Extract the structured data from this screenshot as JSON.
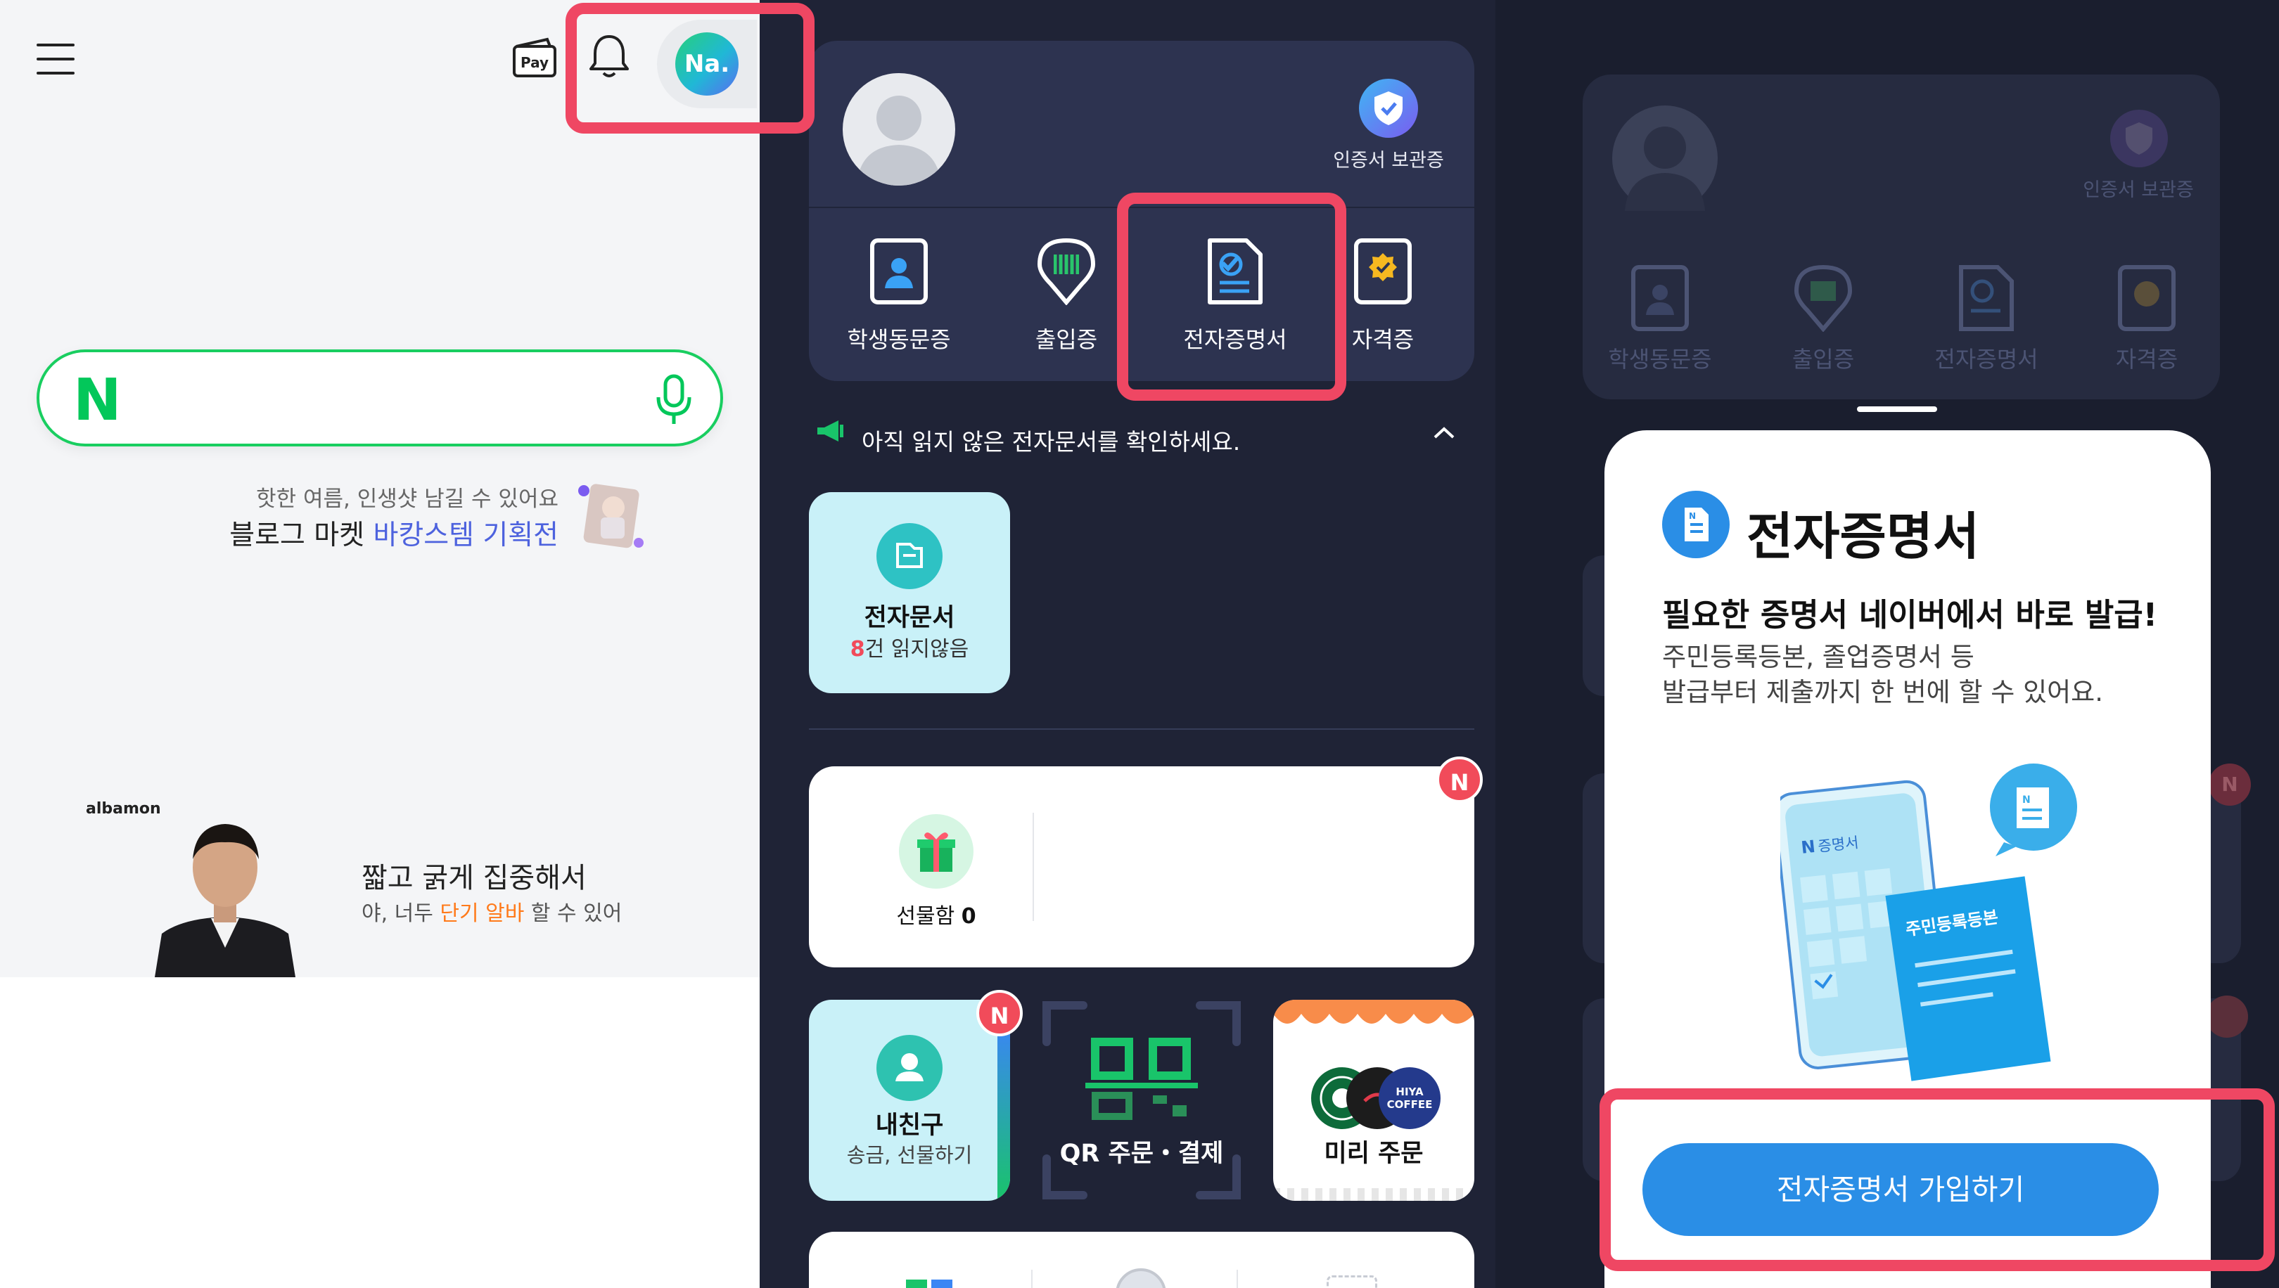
{
  "panel1": {
    "header": {
      "pay_label": "Pay",
      "avatar_text": "Na."
    },
    "promo": {
      "subtitle": "핫한 여름, 인생샷 남길 수 있어요",
      "title_prefix": "블로그 마켓 ",
      "title_accent": "바캉스템 기획전"
    },
    "ad": {
      "brand": "albamon",
      "title": "짧고 굵게 집중해서",
      "sub_prefix": "야, 너두 ",
      "sub_accent": "단기 알바",
      "sub_suffix": " 할 수 있어"
    }
  },
  "panel2": {
    "cert_storage_label": "인증서 보관증",
    "quick_items": [
      {
        "label": "학생동문증"
      },
      {
        "label": "출입증"
      },
      {
        "label": "전자증명서"
      },
      {
        "label": "자격증"
      }
    ],
    "notice": "아직 읽지 않은 전자문서를 확인하세요.",
    "edoc": {
      "title": "전자문서",
      "count": "8",
      "unread_suffix": "건 읽지않음"
    },
    "gift": {
      "label": "선물함",
      "count": "0",
      "badge": "N"
    },
    "friend": {
      "title": "내친구",
      "sub": "송금, 선물하기",
      "badge": "N"
    },
    "qr": {
      "label": "QR 주문・결제"
    },
    "preorder": {
      "label": "미리 주문",
      "logo_text": "HIYA\nCOFFEE"
    }
  },
  "panel3": {
    "cert_storage_label": "인증서 보관증",
    "quick_items": [
      {
        "label": "학생동문증"
      },
      {
        "label": "출입증"
      },
      {
        "label": "전자증명서"
      },
      {
        "label": "자격증"
      }
    ],
    "badge": "N",
    "sheet": {
      "title": "전자증명서",
      "subtitle": "필요한 증명서 네이버에서 바로 발급!",
      "desc_line1": "주민등록등본, 졸업증명서 등",
      "desc_line2": "발급부터 제출까지 한 번에 할 수 있어요.",
      "illus_phone_label": "증명서",
      "illus_doc_label": "주민등록등본",
      "join_button": "전자증명서 가입하기"
    }
  },
  "colors": {
    "naver_green": "#03c75a",
    "highlight": "#ef4763",
    "wallet_bg": "#1f2336",
    "primary_blue": "#2a8ee6",
    "badge_red": "#f14b5a"
  }
}
